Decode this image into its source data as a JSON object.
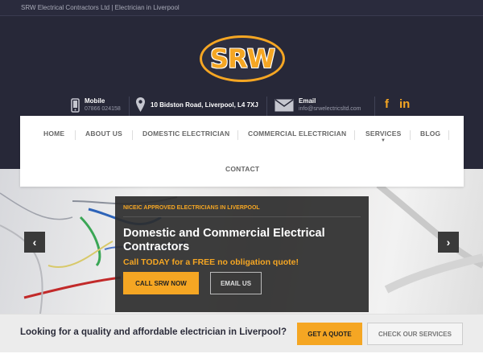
{
  "topbar": {
    "title": "SRW Electrical Contractors Ltd | Electrician in Liverpool"
  },
  "logo": {
    "text": "SRW"
  },
  "contact": {
    "mobile_label": "Mobile",
    "mobile_number": "07866 024158",
    "address": "10 Bidston Road, Liverpool, L4 7XJ",
    "email_label": "Email",
    "email_value": "info@srwelectricsltd.com"
  },
  "social": {
    "facebook": "f",
    "linkedin": "in"
  },
  "nav": {
    "items": [
      "HOME",
      "ABOUT US",
      "DOMESTIC ELECTRICIAN",
      "COMMERCIAL ELECTRICIAN",
      "SERVICES",
      "BLOG",
      "CONTACT"
    ]
  },
  "hero": {
    "tag": "NICEIC APPROVED ELECTRICIANS IN LIVERPOOL",
    "title": "Domestic and Commercial Electrical Contractors",
    "subtitle": "Call TODAY for a FREE no obligation quote!",
    "call_button": "CALL SRW NOW",
    "email_button": "EMAIL US",
    "prev_arrow": "‹",
    "next_arrow": "›"
  },
  "cta": {
    "text": "Looking for a quality and affordable electrician in Liverpool?",
    "quote_button": "GET A QUOTE",
    "services_button": "CHECK OUR SERVICES"
  },
  "colors": {
    "accent": "#f5a623",
    "header_bg": "#272838",
    "caption_bg": "#2d2d2d"
  },
  "icons": [
    "mobile-phone-icon",
    "map-pin-icon",
    "envelope-icon",
    "facebook-icon",
    "linkedin-icon",
    "chevron-left-icon",
    "chevron-right-icon",
    "caret-down-icon"
  ]
}
